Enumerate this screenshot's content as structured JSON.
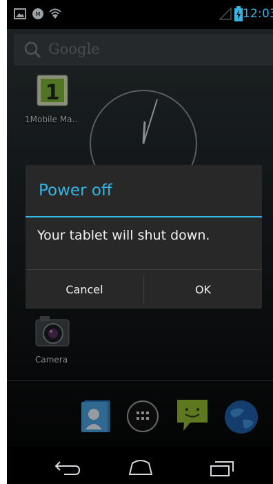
{
  "status_bar": {
    "time": "12:03",
    "left_icons": [
      "gallery-icon",
      "notification-icon",
      "wifi-icon"
    ],
    "right_icons": [
      "signal-icon",
      "battery-charging-icon"
    ]
  },
  "search": {
    "placeholder": "Google"
  },
  "home": {
    "apps": [
      {
        "label": "1Mobile Ma..",
        "icon": "1mobile-market-icon"
      },
      {
        "label": "Camera",
        "icon": "camera-icon"
      }
    ],
    "widgets": [
      "analog-clock"
    ],
    "dock": [
      "contacts-icon",
      "app-drawer-icon",
      "messaging-icon",
      "browser-icon"
    ]
  },
  "dialog": {
    "title": "Power off",
    "message": "Your tablet will shut down.",
    "cancel_label": "Cancel",
    "ok_label": "OK"
  },
  "nav": [
    "back-icon",
    "home-icon",
    "recent-apps-icon"
  ],
  "colors": {
    "accent": "#33b5e5",
    "dialog_bg": "#282828",
    "status_bar_bg": "#000000",
    "dialog_text": "#f2f2f2"
  }
}
